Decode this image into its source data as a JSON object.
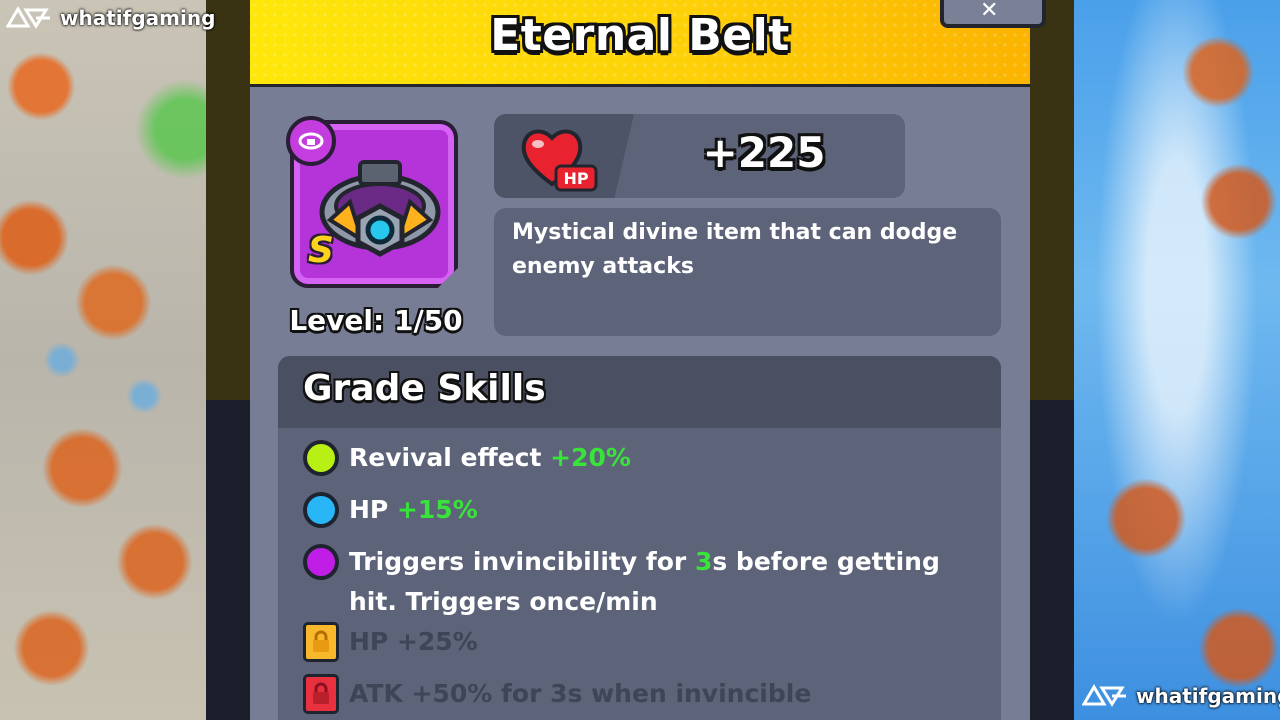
{
  "brand": {
    "name": "whatifgaming"
  },
  "item": {
    "name": "Eternal Belt",
    "grade": "S",
    "level": "Level: 1/50",
    "stat": {
      "icon": "heart-hp-icon",
      "label": "HP",
      "value": "+225"
    },
    "description": "Mystical divine item that can dodge enemy attacks"
  },
  "grade_skills": {
    "title": "Grade Skills",
    "items": [
      {
        "text": "Revival effect ",
        "value": "+20%",
        "dot_color": "#b8f015",
        "locked": false
      },
      {
        "text": "HP ",
        "value": "+15%",
        "dot_color": "#29b6f6",
        "locked": false
      },
      {
        "text_before": "Triggers invincibility for ",
        "value": "3",
        "text_after": "s before getting hit. Triggers once/min",
        "dot_color": "#c01ee6",
        "locked": false
      },
      {
        "text": "HP +25%",
        "lock_color": "#f7b92b",
        "locked": true
      },
      {
        "text": "ATK +50% for 3s when invincible",
        "lock_color": "#e8303e",
        "locked": true
      }
    ]
  },
  "colors": {
    "header_yellow": "#fdd108",
    "panel": "#777d94",
    "box": "#5d6479",
    "highlight_green": "#39e43a",
    "item_purple": "#b534d9"
  }
}
